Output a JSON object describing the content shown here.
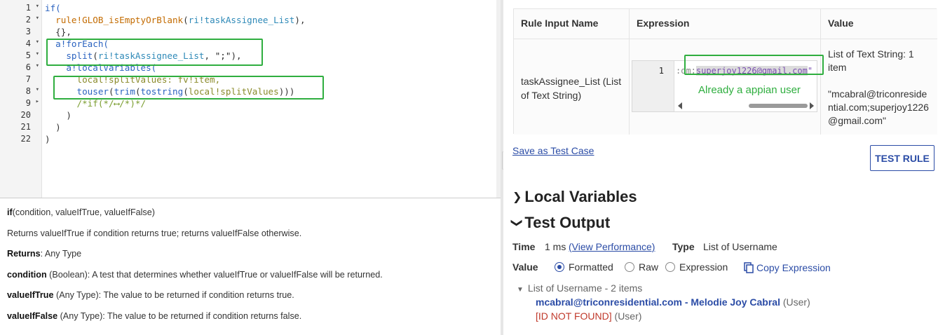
{
  "editor": {
    "lines": [
      {
        "num": "1",
        "fold": "▾"
      },
      {
        "num": "2",
        "fold": "▾"
      },
      {
        "num": "3",
        "fold": ""
      },
      {
        "num": "4",
        "fold": "▾"
      },
      {
        "num": "5",
        "fold": "▾"
      },
      {
        "num": "6",
        "fold": "▾"
      },
      {
        "num": "7",
        "fold": ""
      },
      {
        "num": "8",
        "fold": "▾"
      },
      {
        "num": "9",
        "fold": "▸"
      },
      {
        "num": "20",
        "fold": ""
      },
      {
        "num": "21",
        "fold": ""
      },
      {
        "num": "22",
        "fold": ""
      }
    ],
    "code": {
      "l1": "if(",
      "l2_fn": "rule!GLOB_isEmptyOrBlank",
      "l2_arg": "ri!taskAssignee_List",
      "l3": "{},",
      "l4": "a!forEach(",
      "l5_fn": "split",
      "l5_arg": "ri!taskAssignee_List",
      "l5_str": "\";\"",
      "l6": "a!localVariables(",
      "l7": "local!splitValues: fv!item,",
      "l8_a": "touser",
      "l8_b": "trim",
      "l8_c": "tostring",
      "l8_d": "local!splitValues",
      "l9": "/*if(*/⟷/*)*/",
      "l20": ")",
      "l21": ")",
      "l22": ")"
    }
  },
  "docs": {
    "signature_name": "if",
    "signature_args": "(condition, valueIfTrue, valueIfFalse)",
    "description": "Returns valueIfTrue if condition returns true; returns valueIfFalse otherwise.",
    "returns_label": "Returns",
    "returns_value": ": Any Type",
    "params": [
      {
        "name": "condition",
        "type": " (Boolean)",
        "desc": ": A test that determines whether valueIfTrue or valueIfFalse will be returned."
      },
      {
        "name": "valueIfTrue",
        "type": " (Any Type)",
        "desc": ": The value to be returned if condition returns true."
      },
      {
        "name": "valueIfFalse",
        "type": " (Any Type)",
        "desc": ": The value to be returned if condition returns false."
      }
    ]
  },
  "rule_inputs": {
    "headers": [
      "Rule Input Name",
      "Expression",
      "Value"
    ],
    "row": {
      "name": "taskAssignee_List (List of Text String)",
      "expr_line_num": "1",
      "expr_prefix": ":om;",
      "expr_highlight": "superjoy1226@gmail.com",
      "expr_suffix": "\"",
      "value_head": "List of Text String: 1 item",
      "value_body": "\"mcabral@triconresidential.com;superjoy1226@gmail.com\""
    },
    "annotation": "Already a appian user"
  },
  "actions": {
    "save_test_case": "Save as Test Case",
    "test_rule": "TEST RULE"
  },
  "sections": {
    "local_variables": "Local Variables",
    "test_output": "Test Output"
  },
  "output": {
    "time_label": "Time",
    "time_value": "1 ms",
    "view_performance": "(View Performance)",
    "type_label": "Type",
    "type_value": "List of Username",
    "value_label": "Value",
    "radio_options": [
      "Formatted",
      "Raw",
      "Expression"
    ],
    "selected_option": "Formatted",
    "copy_expression": "Copy Expression",
    "result_header": "List of Username - 2 items",
    "result_user_1_link": "mcabral@triconresidential.com - Melodie Joy Cabral",
    "result_user_1_tag": "(User)",
    "result_user_2_error": "[ID NOT FOUND]",
    "result_user_2_tag": "(User)"
  },
  "colors": {
    "link": "#2b4ca6",
    "annotation_green": "#2fae3f",
    "error_red": "#c0392b"
  }
}
